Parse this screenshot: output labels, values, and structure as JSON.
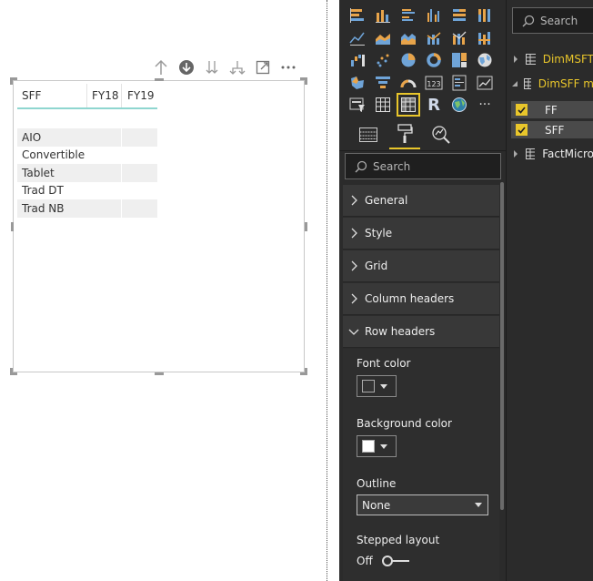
{
  "canvas": {
    "table": {
      "headers": [
        "SFF",
        "FY18",
        "FY19"
      ],
      "rows": [
        "AIO",
        "Convertible",
        "Tablet",
        "Trad DT",
        "Trad NB"
      ]
    },
    "toolbar_icons": [
      "drill-up-icon",
      "drill-down-icon",
      "expand-all-icon",
      "expand-next-level-icon",
      "focus-mode-icon",
      "more-options-icon"
    ]
  },
  "visualizations": {
    "icons": [
      "stacked-bar-icon",
      "stacked-column-icon",
      "clustered-bar-icon",
      "clustered-column-icon",
      "100-stacked-bar-icon",
      "100-stacked-column-icon",
      "line-chart-icon",
      "area-chart-icon",
      "stacked-area-icon",
      "line-clustered-column-icon",
      "line-stacked-column-icon",
      "ribbon-chart-icon",
      "waterfall-icon",
      "scatter-icon",
      "pie-icon",
      "donut-icon",
      "treemap-icon",
      "map-icon",
      "filled-map-icon",
      "funnel-icon",
      "gauge-icon",
      "card-icon",
      "multi-row-card-icon",
      "kpi-icon",
      "slicer-icon",
      "table-icon",
      "matrix-icon",
      "r-visual-icon",
      "globe-icon",
      "more-visuals-icon"
    ],
    "selected_icon": "matrix-icon",
    "r_label": "R",
    "more_label": "···",
    "card_label": "123",
    "tabs": [
      "fields-tab-icon",
      "format-tab-icon",
      "analytics-tab-icon"
    ],
    "search_placeholder": "Search",
    "sections": [
      "General",
      "Style",
      "Grid",
      "Column headers",
      "Row headers"
    ],
    "row_headers": {
      "font_color_label": "Font color",
      "font_color": "#333333",
      "background_color_label": "Background color",
      "background_color": "#ffffff",
      "outline_label": "Outline",
      "outline_value": "None",
      "stepped_layout_label": "Stepped layout",
      "stepped_layout_value": "Off"
    },
    "accent": "#e9c62b"
  },
  "fields": {
    "search_placeholder": "Search",
    "tables": [
      {
        "name": "DimMSFT",
        "expanded": false,
        "color": "#e9c62b"
      },
      {
        "name": "DimSFF m",
        "expanded": true,
        "color": "#e9c62b",
        "fields": [
          "FF",
          "SFF"
        ]
      },
      {
        "name": "FactMicro",
        "expanded": false,
        "color": "#eeeeee"
      }
    ]
  }
}
